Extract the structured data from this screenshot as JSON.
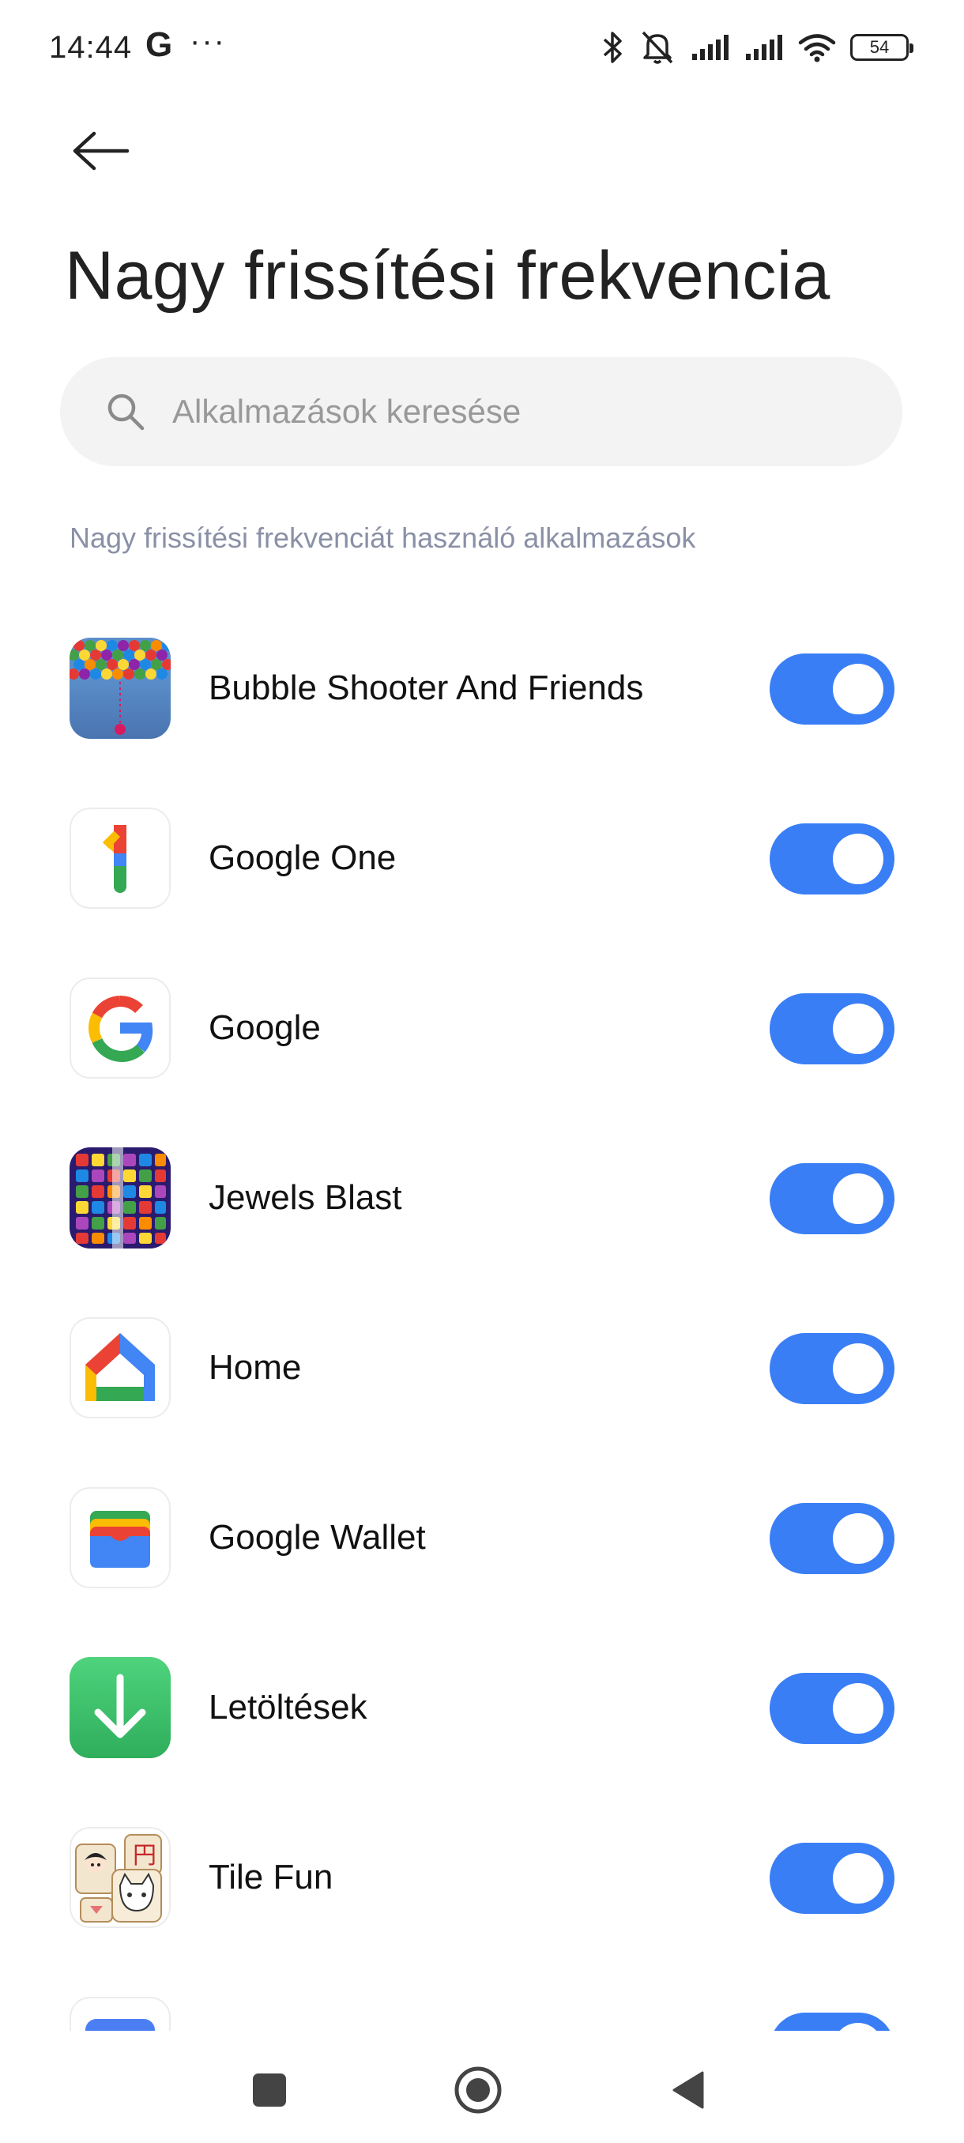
{
  "status_bar": {
    "time": "14:44",
    "g_glyph": "G",
    "more_glyph": "···",
    "battery": "54",
    "icons": [
      "bluetooth-icon",
      "mute-icon",
      "signal-icon",
      "signal-icon",
      "wifi-icon",
      "battery-icon"
    ]
  },
  "header": {
    "back_icon": "arrow-left-icon",
    "title": "Nagy frissítési frekvencia"
  },
  "search": {
    "placeholder": "Alkalmazások keresése",
    "value": ""
  },
  "section_label": "Nagy frissítési frekvenciát használó alkalmazások",
  "apps": [
    {
      "name": "Bubble Shooter And Friends",
      "icon": "bubble-shooter-icon",
      "enabled": true
    },
    {
      "name": "Google One",
      "icon": "google-one-icon",
      "enabled": true
    },
    {
      "name": "Google",
      "icon": "google-icon",
      "enabled": true
    },
    {
      "name": "Jewels Blast",
      "icon": "jewels-blast-icon",
      "enabled": true
    },
    {
      "name": "Home",
      "icon": "google-home-icon",
      "enabled": true
    },
    {
      "name": "Google Wallet",
      "icon": "google-wallet-icon",
      "enabled": true
    },
    {
      "name": "Letöltések",
      "icon": "downloads-icon",
      "enabled": true
    },
    {
      "name": "Tile Fun",
      "icon": "tile-fun-icon",
      "enabled": true
    }
  ],
  "colors": {
    "toggle_on": "#3a7ef6",
    "title": "#222222",
    "section_label": "#8a90a6",
    "search_bg": "#f3f3f3"
  },
  "nav_bar": {
    "icons": [
      "recents-square-icon",
      "home-circle-icon",
      "back-triangle-icon"
    ]
  }
}
